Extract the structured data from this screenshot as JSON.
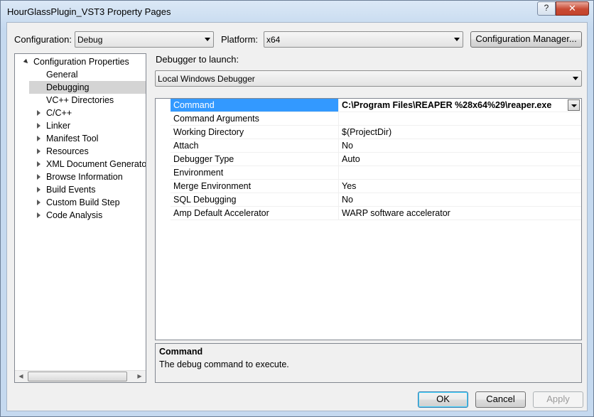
{
  "window": {
    "title": "HourGlassPlugin_VST3 Property Pages",
    "help_glyph": "?",
    "close_glyph": "✕"
  },
  "toolbar": {
    "configuration_label": "Configuration:",
    "configuration_value": "Debug",
    "platform_label": "Platform:",
    "platform_value": "x64",
    "configuration_manager_label": "Configuration Manager..."
  },
  "tree": {
    "root": "Configuration Properties",
    "items": [
      {
        "label": "General",
        "expandable": false,
        "selected": false
      },
      {
        "label": "Debugging",
        "expandable": false,
        "selected": true
      },
      {
        "label": "VC++ Directories",
        "expandable": false,
        "selected": false
      },
      {
        "label": "C/C++",
        "expandable": true,
        "selected": false
      },
      {
        "label": "Linker",
        "expandable": true,
        "selected": false
      },
      {
        "label": "Manifest Tool",
        "expandable": true,
        "selected": false
      },
      {
        "label": "Resources",
        "expandable": true,
        "selected": false
      },
      {
        "label": "XML Document Generator",
        "expandable": true,
        "selected": false
      },
      {
        "label": "Browse Information",
        "expandable": true,
        "selected": false
      },
      {
        "label": "Build Events",
        "expandable": true,
        "selected": false
      },
      {
        "label": "Custom Build Step",
        "expandable": true,
        "selected": false
      },
      {
        "label": "Code Analysis",
        "expandable": true,
        "selected": false
      }
    ]
  },
  "debugger": {
    "label": "Debugger to launch:",
    "value": "Local Windows Debugger"
  },
  "properties": [
    {
      "name": "Command",
      "value": "C:\\Program Files\\REAPER %28x64%29\\reaper.exe",
      "selected": true
    },
    {
      "name": "Command Arguments",
      "value": "",
      "selected": false
    },
    {
      "name": "Working Directory",
      "value": "$(ProjectDir)",
      "selected": false
    },
    {
      "name": "Attach",
      "value": "No",
      "selected": false
    },
    {
      "name": "Debugger Type",
      "value": "Auto",
      "selected": false
    },
    {
      "name": "Environment",
      "value": "",
      "selected": false
    },
    {
      "name": "Merge Environment",
      "value": "Yes",
      "selected": false
    },
    {
      "name": "SQL Debugging",
      "value": "No",
      "selected": false
    },
    {
      "name": "Amp Default Accelerator",
      "value": "WARP software accelerator",
      "selected": false
    }
  ],
  "description": {
    "title": "Command",
    "text": "The debug command to execute."
  },
  "buttons": {
    "ok": "OK",
    "cancel": "Cancel",
    "apply": "Apply"
  }
}
